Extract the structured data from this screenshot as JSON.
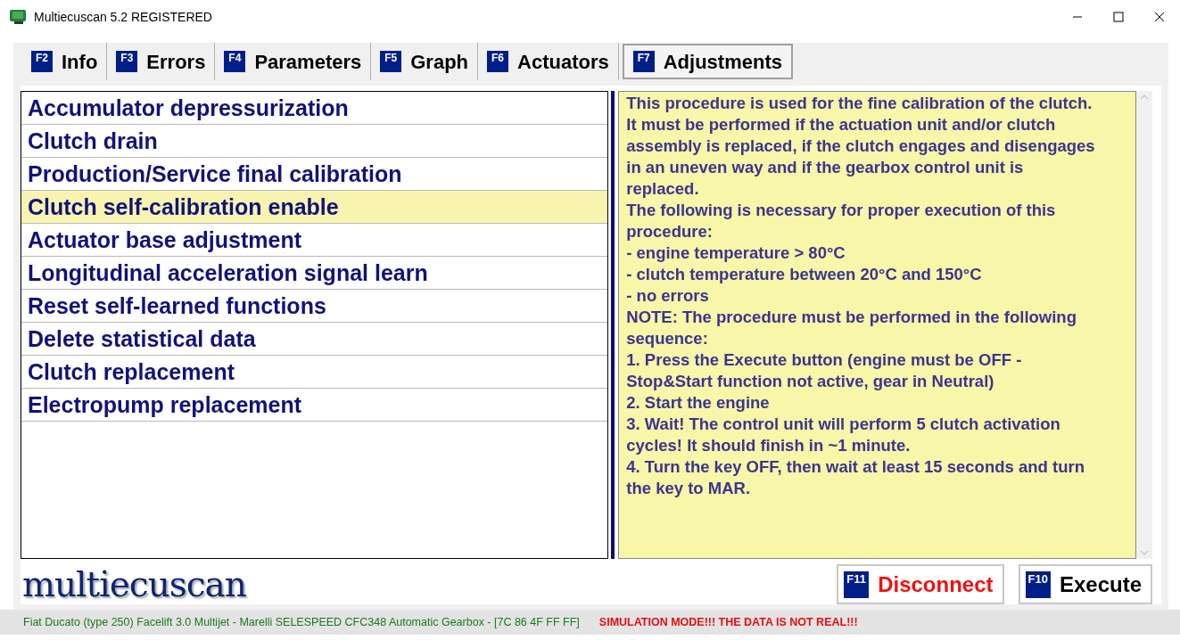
{
  "window": {
    "title": "Multiecuscan 5.2 REGISTERED"
  },
  "tabs": [
    {
      "key": "F2",
      "label": "Info",
      "selected": false
    },
    {
      "key": "F3",
      "label": "Errors",
      "selected": false
    },
    {
      "key": "F4",
      "label": "Parameters",
      "selected": false
    },
    {
      "key": "F5",
      "label": "Graph",
      "selected": false
    },
    {
      "key": "F6",
      "label": "Actuators",
      "selected": false
    },
    {
      "key": "F7",
      "label": "Adjustments",
      "selected": true
    }
  ],
  "procedures": [
    {
      "label": "Accumulator depressurization",
      "selected": false
    },
    {
      "label": "Clutch drain",
      "selected": false
    },
    {
      "label": "Production/Service final calibration",
      "selected": false
    },
    {
      "label": "Clutch self-calibration enable",
      "selected": true
    },
    {
      "label": "Actuator base adjustment",
      "selected": false
    },
    {
      "label": "Longitudinal acceleration signal learn",
      "selected": false
    },
    {
      "label": "Reset self-learned functions",
      "selected": false
    },
    {
      "label": "Delete statistical data",
      "selected": false
    },
    {
      "label": "Clutch replacement",
      "selected": false
    },
    {
      "label": "Electropump replacement",
      "selected": false
    }
  ],
  "description": [
    "This procedure is used for the fine calibration of the clutch.",
    "It must be performed if the actuation unit and/or clutch",
    "assembly is replaced, if the clutch engages and disengages",
    "in an uneven way and if the gearbox control unit is",
    "replaced.",
    "The following is necessary for proper execution of this",
    "procedure:",
    "- engine temperature > 80°C",
    "- clutch temperature between 20°C and 150°C",
    "- no errors",
    "NOTE: The procedure must be performed in the following",
    "sequence:",
    "1. Press the Execute button (engine must be OFF -",
    "Stop&Start function not active, gear in Neutral)",
    "2. Start the engine",
    "3. Wait! The control unit will perform 5 clutch activation",
    "cycles! It should finish in ~1 minute.",
    "4. Turn the key OFF, then wait at least 15 seconds and turn",
    "the key to MAR."
  ],
  "logo": "multiecuscan",
  "buttons": [
    {
      "key": "F11",
      "label": "Disconnect",
      "kind": "danger"
    },
    {
      "key": "F10",
      "label": "Execute",
      "kind": "normal"
    }
  ],
  "status_bar": {
    "vehicle": "Fiat Ducato (type 250) Facelift 3.0 Multijet - Marelli SELESPEED CFC348 Automatic Gearbox - [7C 86 4F FF FF]",
    "warning": "SIMULATION MODE!!! THE DATA IS NOT REAL!!!"
  }
}
